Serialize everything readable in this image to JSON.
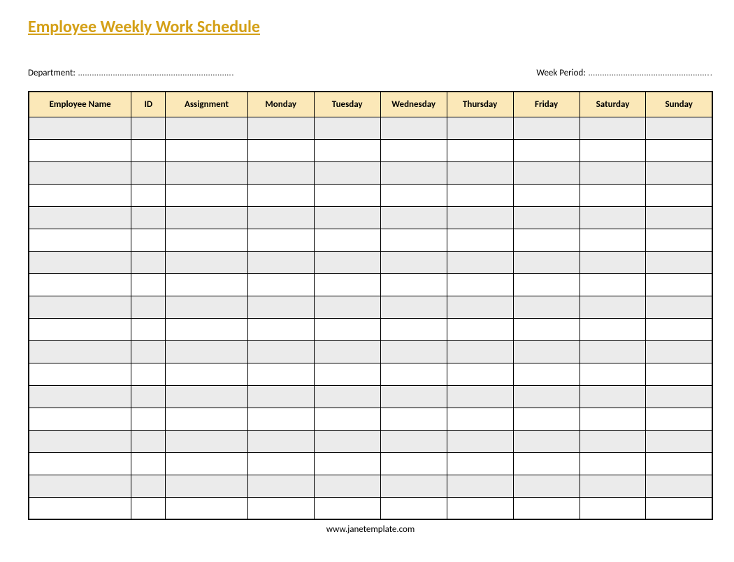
{
  "title": "Employee Weekly Work Schedule",
  "info": {
    "department_label": "Department:",
    "department_dots": "………………………………………………………….",
    "week_period_label": "Week Period:",
    "week_period_dots": "…………………………………………….."
  },
  "table": {
    "headers": [
      "Employee Name",
      "ID",
      "Assignment",
      "Monday",
      "Tuesday",
      "Wednesday",
      "Thursday",
      "Friday",
      "Saturday",
      "Sunday"
    ],
    "row_count": 18
  },
  "footer": "www.janetemplate.com"
}
